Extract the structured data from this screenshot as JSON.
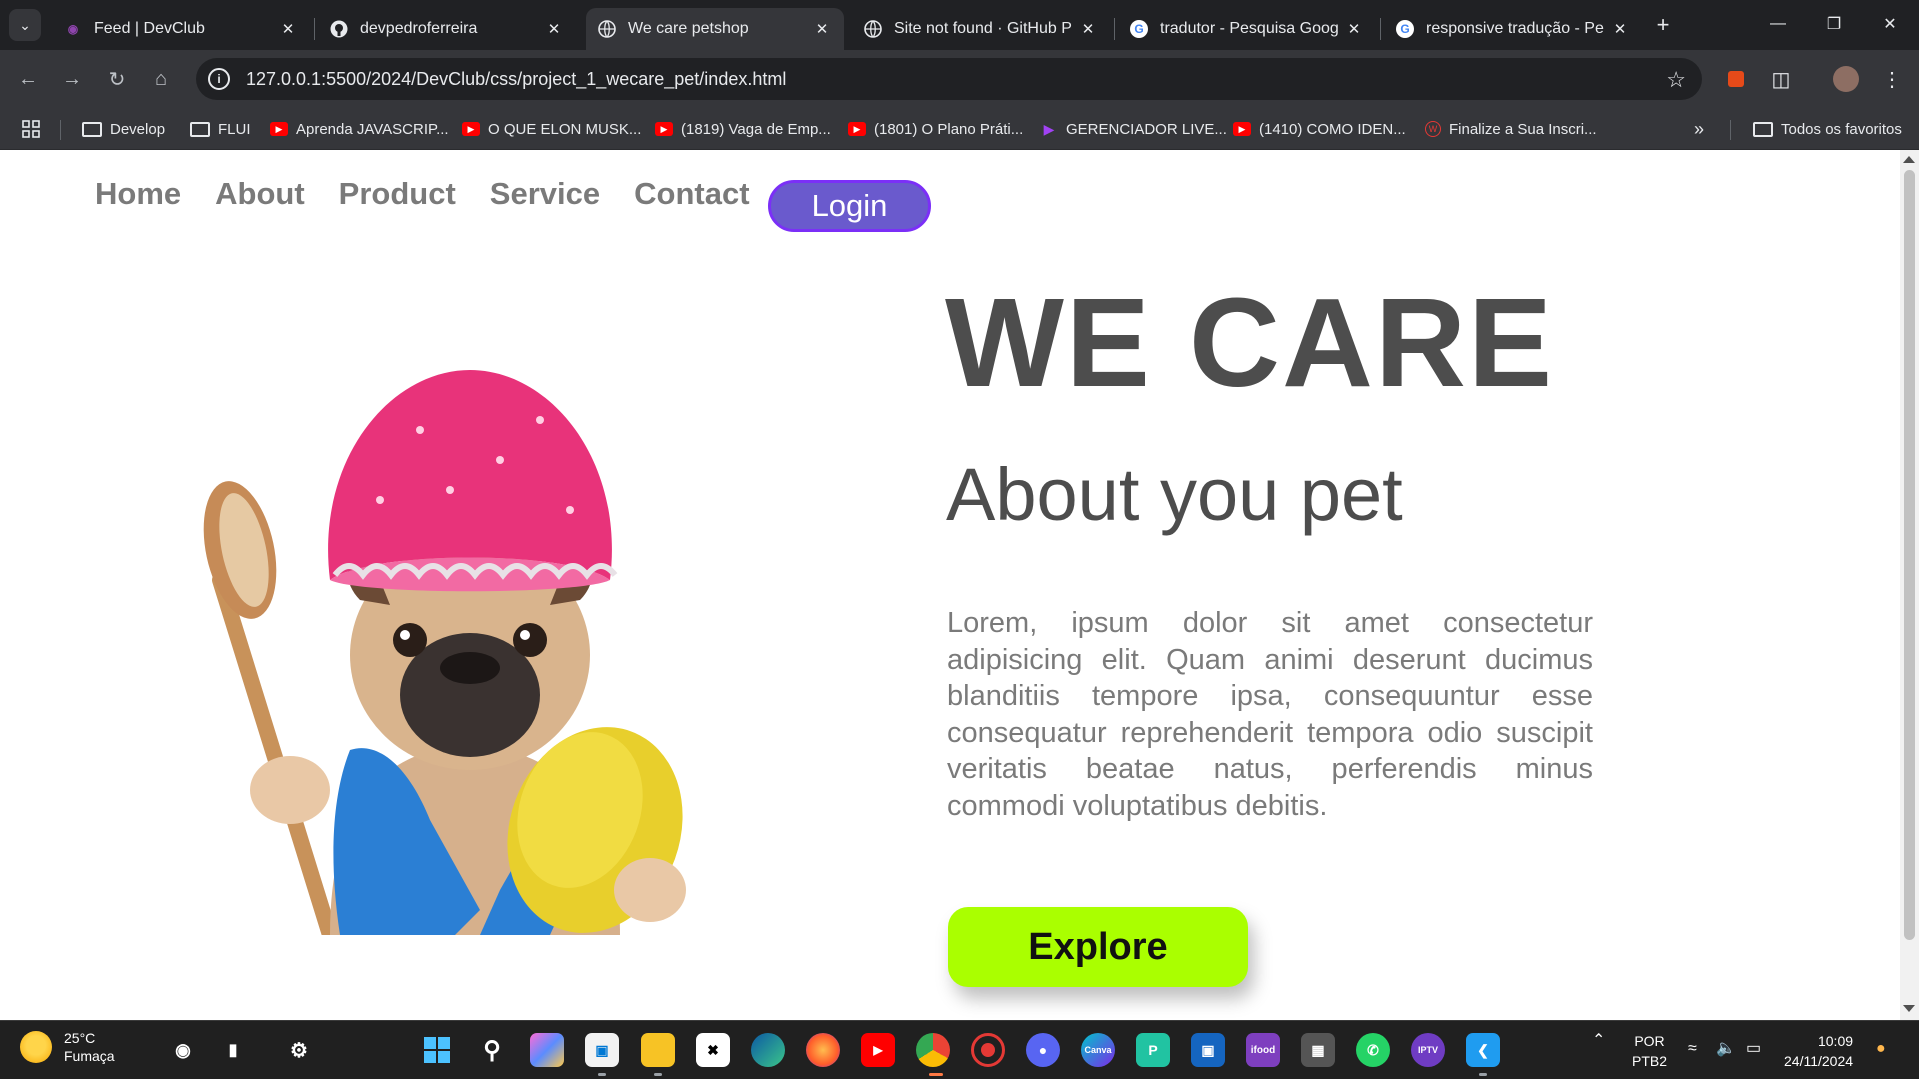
{
  "browser": {
    "tabs": [
      {
        "title": "Feed | DevClub",
        "icon": "devclub-icon",
        "active": false
      },
      {
        "title": "devpedroferreira",
        "icon": "github-icon",
        "active": false
      },
      {
        "title": "We care petshop",
        "icon": "globe-icon",
        "active": true
      },
      {
        "title": "Site not found · GitHub Pa",
        "icon": "globe-icon",
        "active": false
      },
      {
        "title": "tradutor - Pesquisa Google",
        "icon": "google-icon",
        "active": false
      },
      {
        "title": "responsive tradução - Pesq",
        "icon": "google-icon",
        "active": false
      }
    ],
    "url": "127.0.0.1:5500/2024/DevClub/css/project_1_wecare_pet/index.html",
    "bookmarks": [
      {
        "label": "Develop",
        "icon": "folder-icon"
      },
      {
        "label": "FLUI",
        "icon": "folder-icon"
      },
      {
        "label": "Aprenda JAVASCRIP...",
        "icon": "youtube-icon"
      },
      {
        "label": "O QUE ELON MUSK...",
        "icon": "youtube-icon"
      },
      {
        "label": "(1819) Vaga de Emp...",
        "icon": "youtube-icon"
      },
      {
        "label": "(1801) O Plano Práti...",
        "icon": "youtube-icon"
      },
      {
        "label": "GERENCIADOR LIVE...",
        "icon": "play-icon"
      },
      {
        "label": "(1410) COMO IDEN...",
        "icon": "youtube-icon"
      },
      {
        "label": "Finalize a Sua Inscri...",
        "icon": "w-icon"
      }
    ],
    "all_bookmarks_label": "Todos os favoritos"
  },
  "page": {
    "nav": [
      "Home",
      "About",
      "Product",
      "Service",
      "Contact"
    ],
    "login_label": "Login",
    "title": "WE CARE",
    "subtitle": "About you pet",
    "body": "Lorem, ipsum dolor sit amet consectetur adipisicing elit. Quam animi deserunt ducimus blanditiis tempore ipsa, consequuntur esse consequatur reprehenderit tempora odio suscipit veritatis beatae natus, perferendis minus commodi voluptatibus debitis.",
    "explore_label": "Explore",
    "colors": {
      "login": "#6a5acd",
      "explore": "#aaff00",
      "heading": "#4d4d4d",
      "text": "#7a7a7a"
    }
  },
  "taskbar": {
    "weather_temp": "25°C",
    "weather_desc": "Fumaça",
    "lang_top": "POR",
    "lang_bottom": "PTB2",
    "time": "10:09",
    "date": "24/11/2024"
  }
}
